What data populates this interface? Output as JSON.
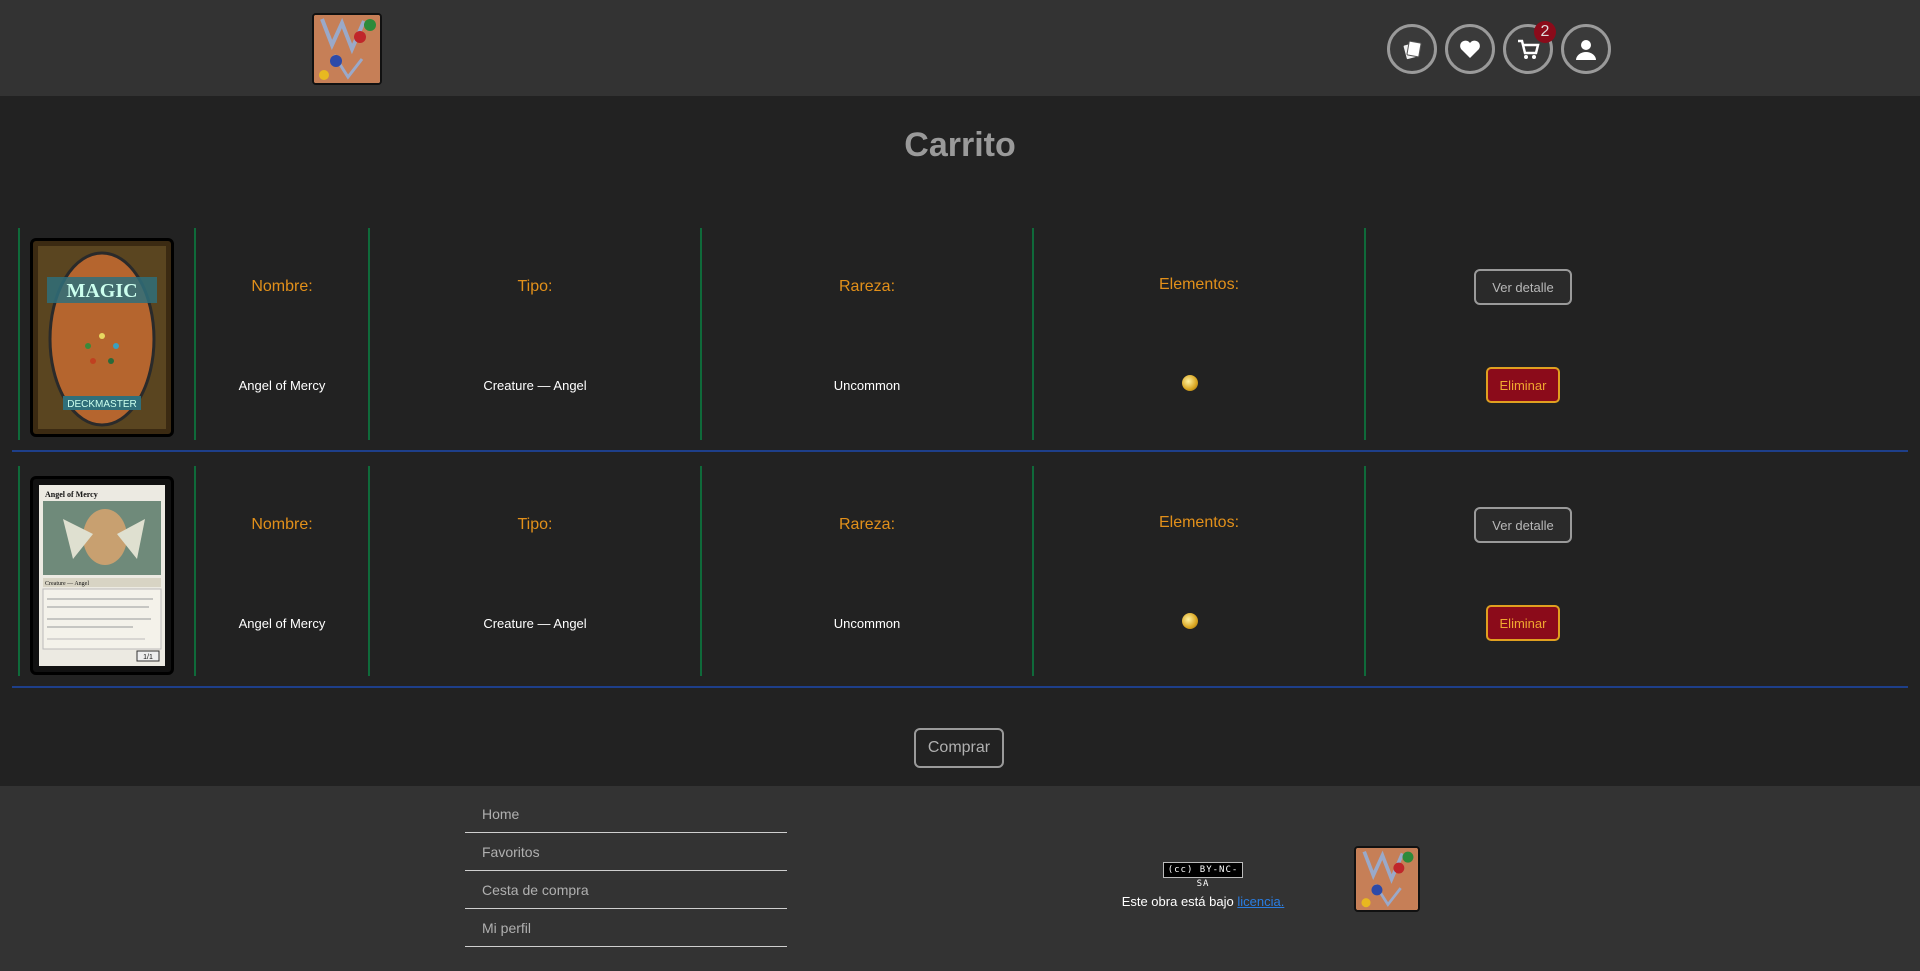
{
  "header": {
    "logo_alt": "Card logo",
    "icons": [
      "cards-icon",
      "heart-icon",
      "cart-icon",
      "user-icon"
    ],
    "cart_count": "2"
  },
  "main": {
    "title": "Carrito",
    "labels": {
      "name": "Nombre:",
      "type": "Tipo:",
      "rarity": "Rareza:",
      "elements": "Elementos:"
    },
    "items": [
      {
        "name": "Angel of Mercy",
        "type": "Creature — Angel",
        "rarity": "Uncommon",
        "element": "white-mana",
        "image": "card-back",
        "detail_label": "Ver detalle",
        "delete_label": "Eliminar"
      },
      {
        "name": "Angel of Mercy",
        "type": "Creature — Angel",
        "rarity": "Uncommon",
        "element": "white-mana",
        "image": "card-front",
        "detail_label": "Ver detalle",
        "delete_label": "Eliminar"
      }
    ],
    "buy_label": "Comprar"
  },
  "footer": {
    "links": [
      "Home",
      "Favoritos",
      "Cesta de compra",
      "Mi perfil"
    ],
    "cc_badge": "(cc) BY-NC-SA",
    "license_text": "Este obra está bajo",
    "license_link": "licencia."
  },
  "colors": {
    "accent": "#e2901a",
    "danger": "#8b0b1a",
    "separator": "#1e3f8a",
    "column_line": "#0f6a3a"
  }
}
